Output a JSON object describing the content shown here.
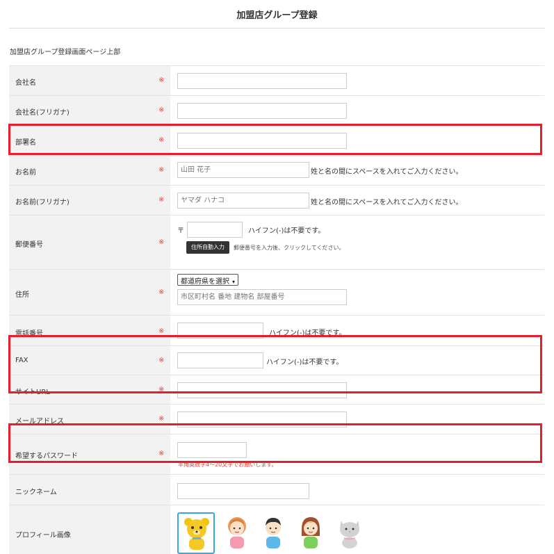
{
  "header": {
    "title": "加盟店グループ登録"
  },
  "intro": {
    "text": "加盟店グループ登録画面ページ上部"
  },
  "required_mark": "※",
  "rows": {
    "company_name": {
      "label": "会社名",
      "value": ""
    },
    "company_kana": {
      "label": "会社名(フリガナ)",
      "value": ""
    },
    "department": {
      "label": "部署名",
      "value": ""
    },
    "name": {
      "label": "お名前",
      "placeholder": "山田 花子",
      "note": "姓と名の間にスペースを入れてご入力ください。"
    },
    "name_kana": {
      "label": "お名前(フリガナ)",
      "placeholder": "ヤマダ ハナコ",
      "note": "姓と名の間にスペースを入れてご入力ください。"
    },
    "postal": {
      "label": "郵便番号",
      "prefix": "〒",
      "note": "ハイフン(-)は不要です。",
      "button": "住所自動入力",
      "button_note": "郵便番号を入力後、クリックしてください。"
    },
    "address": {
      "label": "住所",
      "select_value": "都道府県を選択",
      "placeholder": "市区町村名 番地 建物名 部屋番号"
    },
    "phone": {
      "label": "電話番号",
      "note": "ハイフン(-)は不要です。"
    },
    "fax": {
      "label": "FAX",
      "note": "ハイフン(-)は不要です。"
    },
    "site_url": {
      "label": "サイトURL"
    },
    "email": {
      "label": "メールアドレス"
    },
    "password": {
      "label": "希望するパスワード",
      "note": "半角英数字4～20文字でお願いします。"
    },
    "nickname": {
      "label": "ニックネーム"
    },
    "profile_image": {
      "label": "プロフィール画像",
      "options": [
        "bear-avatar",
        "girl-avatar",
        "boy-avatar",
        "woman-avatar",
        "cat-avatar"
      ],
      "selected": "bear-avatar"
    }
  },
  "colors": {
    "highlight": "#e61e2c",
    "required": "#e83a3a",
    "selected_border": "#33a9e0"
  }
}
